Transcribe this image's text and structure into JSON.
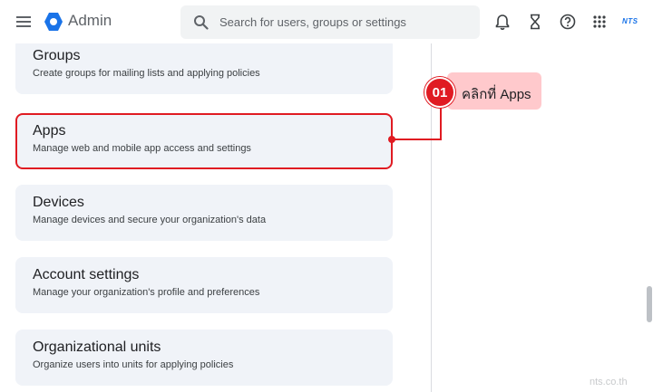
{
  "header": {
    "app_name": "Admin",
    "search_placeholder": "Search for users, groups or settings",
    "brand": "NTS"
  },
  "cards": [
    {
      "title": "Groups",
      "description": "Create groups for mailing lists and applying policies"
    },
    {
      "title": "Apps",
      "description": "Manage web and mobile app access and settings"
    },
    {
      "title": "Devices",
      "description": "Manage devices and secure your organization's data"
    },
    {
      "title": "Account settings",
      "description": "Manage your organization's profile and preferences"
    },
    {
      "title": "Organizational units",
      "description": "Organize users into units for applying policies"
    }
  ],
  "annotation": {
    "step": "01",
    "text": "คลิกที่ Apps",
    "color": "#e01b22"
  },
  "watermark": "nts.co.th",
  "colors": {
    "card_bg": "#f0f3f8",
    "accent": "#1a73e8",
    "highlight": "#e01b22"
  },
  "icons": [
    "menu-icon",
    "admin-logo-icon",
    "search-icon",
    "bell-icon",
    "hourglass-icon",
    "help-icon",
    "apps-grid-icon"
  ]
}
